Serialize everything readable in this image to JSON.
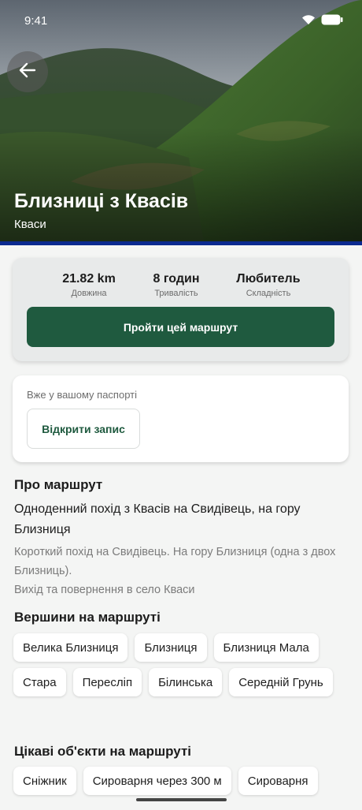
{
  "status_bar": {
    "time": "9:41"
  },
  "hero": {
    "title": "Близниці з Квасів",
    "subtitle": "Кваси"
  },
  "stats": [
    {
      "value": "21.82 km",
      "label": "Довжина"
    },
    {
      "value": "8 годин",
      "label": "Тривалість"
    },
    {
      "value": "Любитель",
      "label": "Складність"
    }
  ],
  "actions": {
    "start_route": "Пройти цей маршрут"
  },
  "passport": {
    "note": "Вже у вашому паспорті",
    "open_button": "Відкрити запис"
  },
  "about": {
    "heading": "Про маршрут",
    "summary": "Одноденний похід з Квасів на Свидівець, на гору Близниця",
    "description_line1": "Короткий похід на Свидівець. На гору Близниця (одна з двох Близниць).",
    "description_line2": "Вихід та повернення в село Кваси"
  },
  "peaks": {
    "heading": "Вершини на маршруті",
    "items": [
      "Велика Близниця",
      "Близниця",
      "Близниця Мала",
      "Стара",
      "Переслiп",
      "Бiлинська",
      "Середнiй Грунь"
    ]
  },
  "poi": {
    "heading": "Цікаві об'єкти на маршруті",
    "items": [
      "Сніжник",
      "Сироварня через 300 м",
      "Сироварня"
    ]
  },
  "icons": {
    "back": "arrow-left-icon",
    "wifi": "wifi-icon",
    "battery": "battery-icon"
  },
  "colors": {
    "primary": "#1f5a3f",
    "accent_line": "#0b2a8f"
  }
}
